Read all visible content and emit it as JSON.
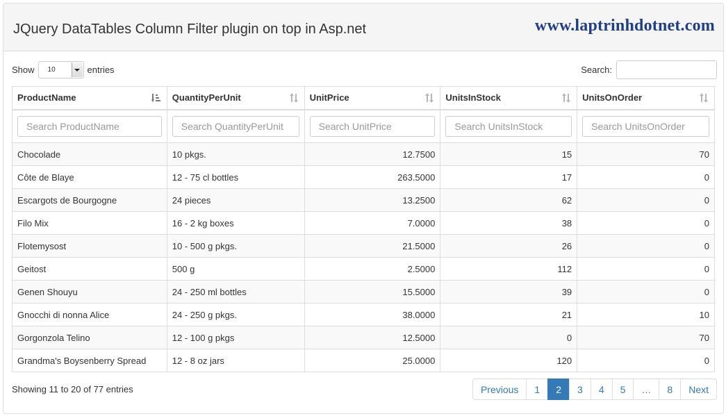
{
  "header": {
    "title": "JQuery DataTables Column Filter plugin on top in Asp.net",
    "brand": "www.laptrinhdotnet.com"
  },
  "length": {
    "show_label": "Show",
    "value": "10",
    "entries_label": "entries"
  },
  "search": {
    "label": "Search:",
    "value": ""
  },
  "table": {
    "columns": [
      "ProductName",
      "QuantityPerUnit",
      "UnitPrice",
      "UnitsInStock",
      "UnitsOnOrder"
    ],
    "filters": [
      "Search ProductName",
      "Search QuantityPerUnit",
      "Search UnitPrice",
      "Search UnitsInStock",
      "Search UnitsOnOrder"
    ],
    "rows": [
      [
        "Chocolade",
        "10 pkgs.",
        "12.7500",
        "15",
        "70"
      ],
      [
        "Côte de Blaye",
        "12 - 75 cl bottles",
        "263.5000",
        "17",
        "0"
      ],
      [
        "Escargots de Bourgogne",
        "24 pieces",
        "13.2500",
        "62",
        "0"
      ],
      [
        "Filo Mix",
        "16 - 2 kg boxes",
        "7.0000",
        "38",
        "0"
      ],
      [
        "Flotemysost",
        "10 - 500 g pkgs.",
        "21.5000",
        "26",
        "0"
      ],
      [
        "Geitost",
        "500 g",
        "2.5000",
        "112",
        "0"
      ],
      [
        "Genen Shouyu",
        "24 - 250 ml bottles",
        "15.5000",
        "39",
        "0"
      ],
      [
        "Gnocchi di nonna Alice",
        "24 - 250 g pkgs.",
        "38.0000",
        "21",
        "10"
      ],
      [
        "Gorgonzola Telino",
        "12 - 100 g pkgs",
        "12.5000",
        "0",
        "70"
      ],
      [
        "Grandma's Boysenberry Spread",
        "12 - 8 oz jars",
        "25.0000",
        "120",
        "0"
      ]
    ]
  },
  "info": "Showing 11 to 20 of 77 entries",
  "pagination": {
    "previous": "Previous",
    "pages": [
      "1",
      "2",
      "3",
      "4",
      "5",
      "…",
      "8"
    ],
    "active": "2",
    "next": "Next"
  },
  "colors": {
    "accent": "#337ab7",
    "brand": "#1f3f8a",
    "border": "#dddddd"
  },
  "icons": {
    "sort_active": "sort-amount-asc-icon",
    "sort_inactive": "sort-both-icon"
  }
}
